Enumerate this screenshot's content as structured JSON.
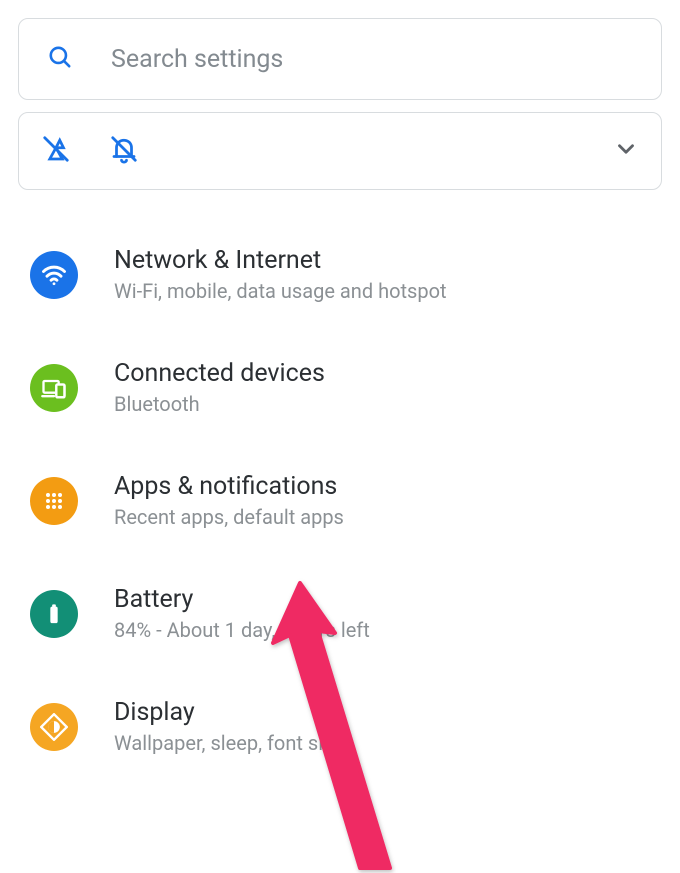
{
  "search": {
    "placeholder": "Search settings"
  },
  "items": [
    {
      "title": "Network & Internet",
      "subtitle": "Wi-Fi, mobile, data usage and hotspot"
    },
    {
      "title": "Connected devices",
      "subtitle": "Bluetooth"
    },
    {
      "title": "Apps & notifications",
      "subtitle": "Recent apps, default apps"
    },
    {
      "title": "Battery",
      "subtitle": "84% - About 1 day, 10 hrs left"
    },
    {
      "title": "Display",
      "subtitle": "Wallpaper, sleep, font size"
    }
  ],
  "colors": {
    "accent": "#1a73e8",
    "annotation": "#ef2a63"
  }
}
